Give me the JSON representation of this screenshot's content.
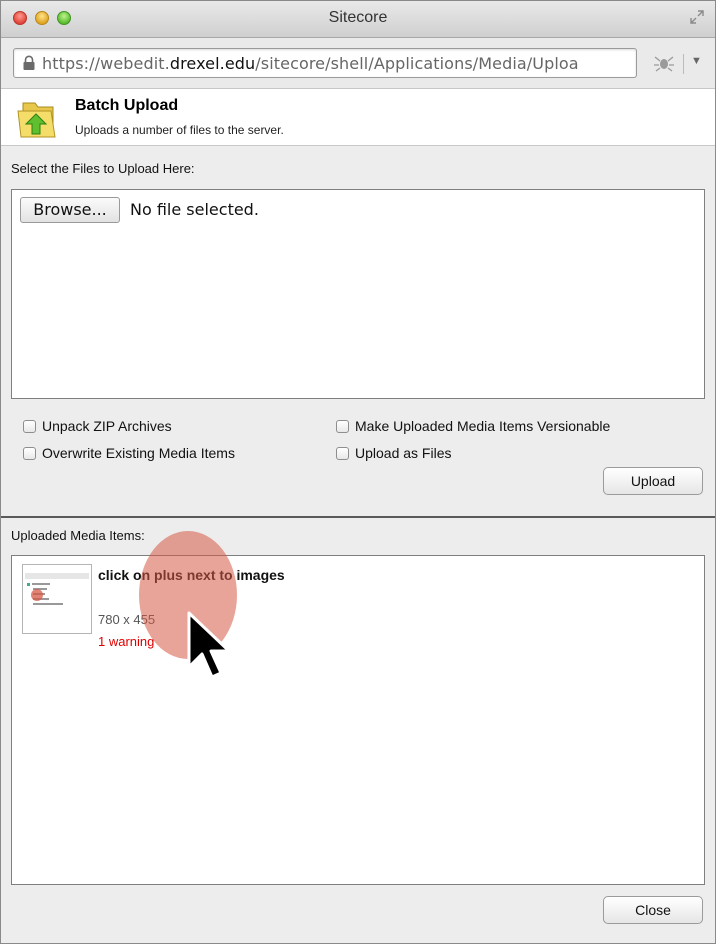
{
  "window": {
    "title": "Sitecore",
    "url_prefix": "https://webedit.",
    "url_host": "drexel.edu",
    "url_path": "/sitecore/shell/Applications/Media/Uploa"
  },
  "header": {
    "title": "Batch Upload",
    "subtitle": "Uploads a number of files to the server."
  },
  "upload": {
    "select_label": "Select the Files to Upload Here:",
    "browse_label": "Browse...",
    "file_status": "No file selected."
  },
  "options": {
    "unpack_zip": "Unpack ZIP Archives",
    "overwrite": "Overwrite Existing Media Items",
    "versionable": "Make Uploaded Media Items Versionable",
    "as_files": "Upload as Files",
    "upload_button": "Upload"
  },
  "uploaded": {
    "label": "Uploaded Media Items:",
    "items": [
      {
        "title": "click on plus next to images",
        "dimensions": "780 x 455",
        "warning": "1 warning"
      }
    ]
  },
  "footer": {
    "close_button": "Close"
  },
  "icons": {
    "lock": "lock-icon",
    "bug": "firebug-icon",
    "folder": "upload-folder-icon",
    "fullscreen": "fullscreen-icon"
  },
  "colors": {
    "warning": "#e00000",
    "highlight": "#d65a46"
  }
}
